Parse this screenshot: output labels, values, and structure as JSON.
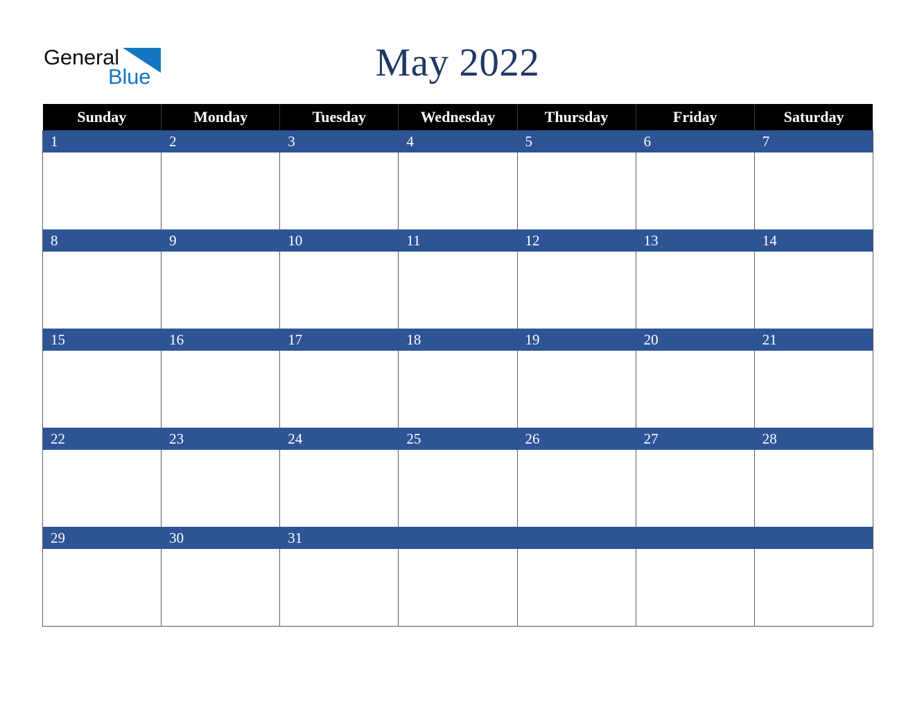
{
  "brand": {
    "name_part1": "General",
    "name_part2": "Blue",
    "logo_icon": "triangle-icon",
    "accent_color": "#1476c0"
  },
  "calendar": {
    "title": "May 2022",
    "month": "May",
    "year": "2022",
    "title_color": "#1f3864",
    "header_bg": "#000000",
    "header_text_color": "#ffffff",
    "date_bar_color": "#2e5496",
    "date_text_color": "#ffffff",
    "cell_bg": "#ffffff",
    "border_color": "#5a5a5a",
    "weekdays": [
      "Sunday",
      "Monday",
      "Tuesday",
      "Wednesday",
      "Thursday",
      "Friday",
      "Saturday"
    ],
    "weeks": [
      [
        "1",
        "2",
        "3",
        "4",
        "5",
        "6",
        "7"
      ],
      [
        "8",
        "9",
        "10",
        "11",
        "12",
        "13",
        "14"
      ],
      [
        "15",
        "16",
        "17",
        "18",
        "19",
        "20",
        "21"
      ],
      [
        "22",
        "23",
        "24",
        "25",
        "26",
        "27",
        "28"
      ],
      [
        "29",
        "30",
        "31",
        "",
        "",
        "",
        ""
      ]
    ]
  }
}
